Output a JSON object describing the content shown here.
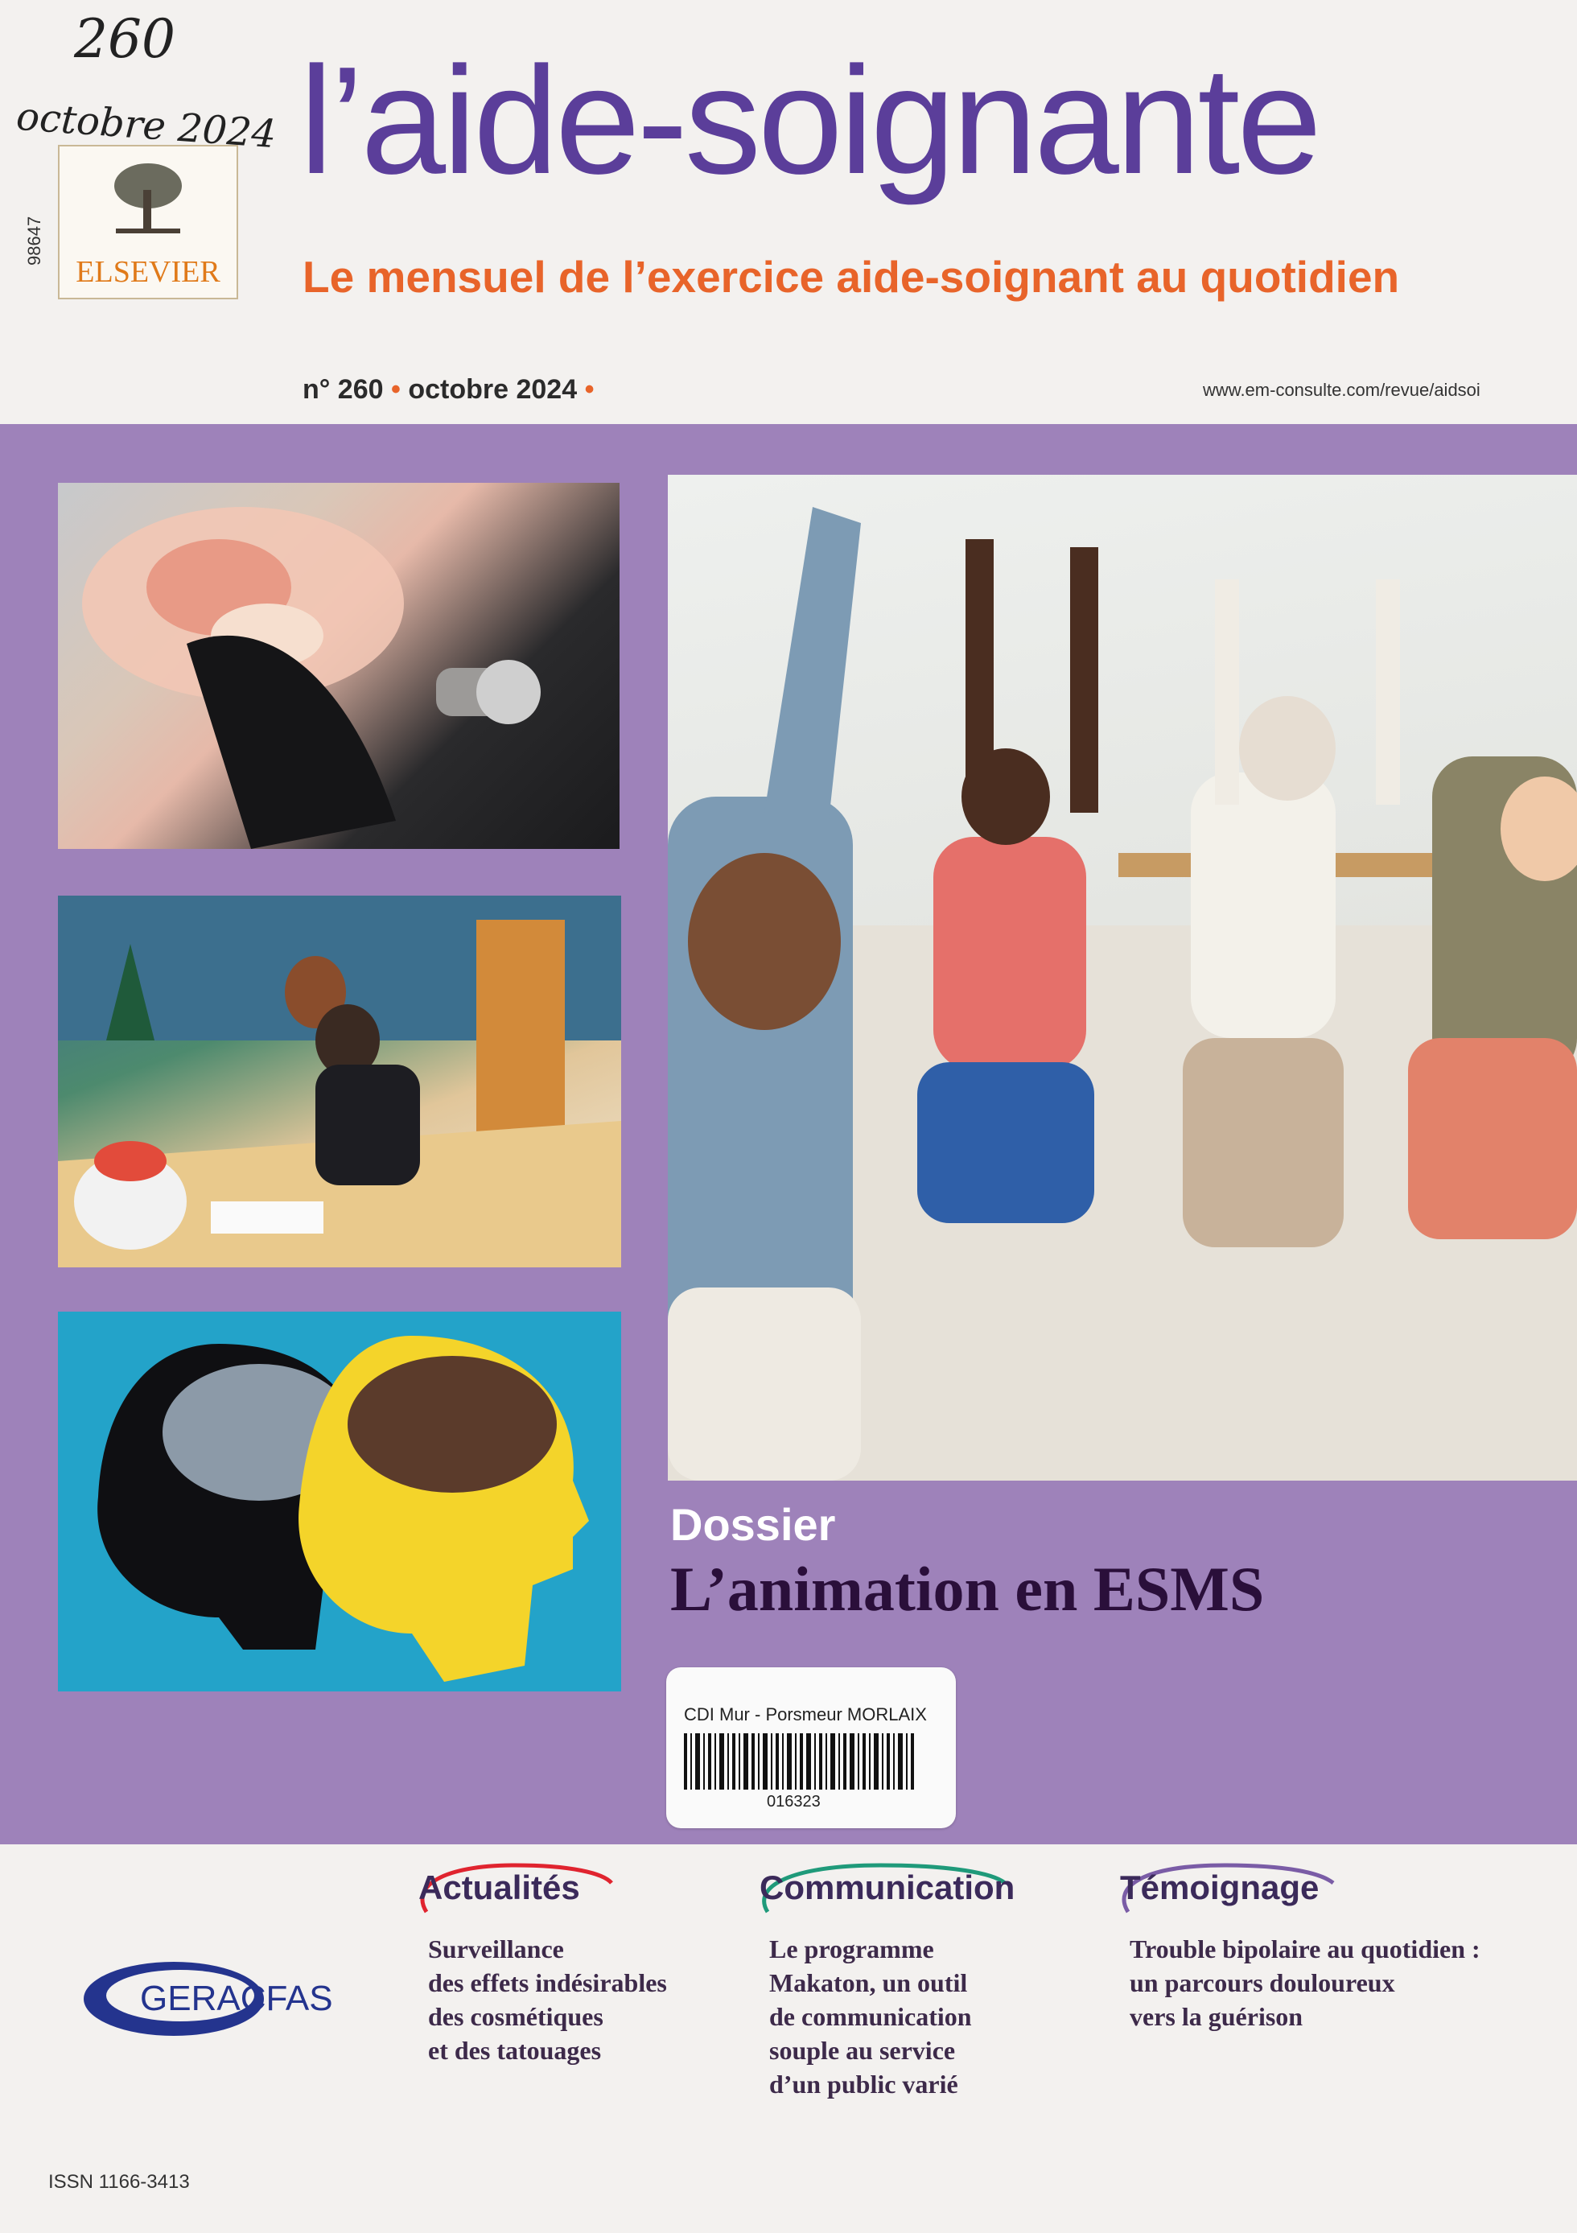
{
  "handwriting": {
    "issue_number": "260",
    "date_note": "octobre 2024"
  },
  "publisher": {
    "code": "98647",
    "logo_text": "ELSEVIER"
  },
  "masthead": {
    "title": "l’aide-soignante",
    "subtitle": "Le mensuel de l’exercice aide-soignant au quotidien",
    "issue_label": "n° 260",
    "issue_month": "octobre 2024",
    "separator": "•",
    "url": "www.em-consulte.com/revue/aidsoi"
  },
  "dossier": {
    "kicker": "Dossier",
    "title": "L’animation en ESMS"
  },
  "library_label": {
    "library": "CDI Mur - Porsmeur MORLAIX",
    "number": "016323"
  },
  "sections": [
    {
      "heading": "Actualités",
      "lines": [
        "Surveillance",
        "des effets indésirables",
        "des cosmétiques",
        "et des tatouages"
      ]
    },
    {
      "heading": "Communication",
      "lines": [
        "Le programme",
        "Makaton, un outil",
        "de communication",
        "souple au service",
        "d’un public varié"
      ]
    },
    {
      "heading": "Témoignage",
      "lines": [
        "Trouble bipolaire au quotidien :",
        "un parcours douloureux",
        "vers la guérison"
      ]
    }
  ],
  "sponsor": {
    "logo_text": "GERACFAS"
  },
  "issn": "ISSN 1166-3413",
  "colors": {
    "purple": "#9e82ba",
    "title_purple": "#5b3e9a",
    "orange": "#e8642a",
    "dark_plum": "#2a0f3a"
  }
}
